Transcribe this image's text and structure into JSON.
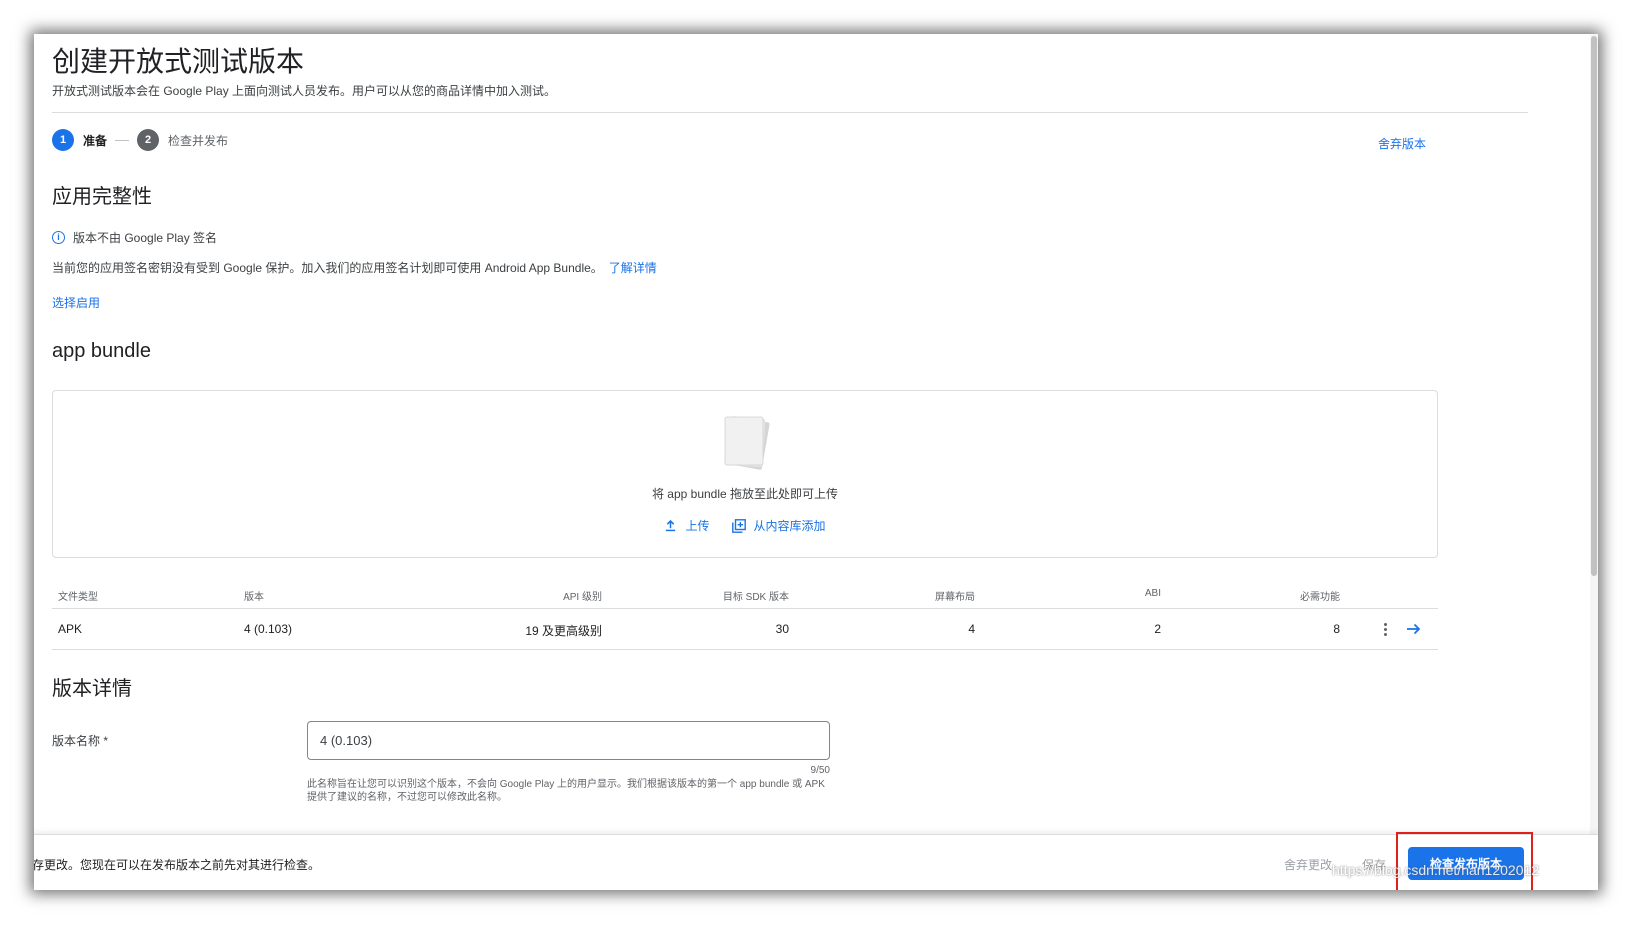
{
  "page": {
    "title": "创建开放式测试版本",
    "subtitle": "开放式测试版本会在 Google Play 上面向测试人员发布。用户可以从您的商品详情中加入测试。"
  },
  "stepper": {
    "steps": [
      {
        "number": "1",
        "label": "准备",
        "active": true
      },
      {
        "number": "2",
        "label": "检查并发布",
        "active": false
      }
    ]
  },
  "discard_release_label": "舍弃版本",
  "app_integrity": {
    "title": "应用完整性",
    "info_icon": "info-icon",
    "notice": "版本不由 Google Play 签名",
    "description": "当前您的应用签名密钥没有受到 Google 保护。加入我们的应用签名计划即可使用 Android App Bundle。",
    "learn_more": "了解详情",
    "opt_in": "选择启用"
  },
  "app_bundle": {
    "title": "app bundle",
    "drop_text": "将 app bundle 拖放至此处即可上传",
    "upload_label": "上传",
    "upload_icon": "upload-icon",
    "add_from_library_label": "从内容库添加",
    "library_icon": "library-add-icon"
  },
  "bundle_table": {
    "headers": [
      "文件类型",
      "版本",
      "API 级别",
      "目标 SDK 版本",
      "屏幕布局",
      "ABI",
      "必需功能"
    ],
    "rows": [
      [
        "APK",
        "4 (0.103)",
        "19 及更高级别",
        "30",
        "4",
        "2",
        "8"
      ]
    ],
    "row_icons": [
      "more-vert-icon",
      "arrow-forward-icon"
    ]
  },
  "release_details": {
    "title": "版本详情",
    "name_label": "版本名称 *",
    "name_value": "4 (0.103)",
    "char_count": "9/50",
    "helper_text": "此名称旨在让您可以识别这个版本，不会向 Google Play 上的用户显示。我们根据该版本的第一个 app bundle 或 APK 提供了建议的名称，不过您可以修改此名称。"
  },
  "footer": {
    "message": "存更改。您现在可以在发布版本之前先对其进行检查。",
    "discard_changes": "舍弃更改",
    "save": "保存",
    "review_release": "检查发布版本"
  },
  "colors": {
    "accent": "#1a73e8",
    "highlight": "#e0201b"
  },
  "watermark": "https://blog.csdn.net/han1202012"
}
